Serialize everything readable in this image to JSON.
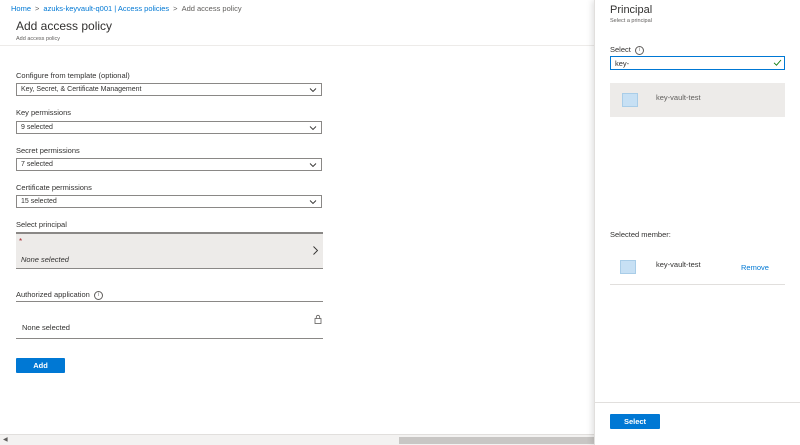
{
  "breadcrumb": {
    "home": "Home",
    "vault": "azuks-keyvault-q001 | Access policies",
    "current": "Add access policy"
  },
  "page": {
    "title": "Add access policy",
    "subtitle": "Add access policy"
  },
  "form": {
    "template_label": "Configure from template (optional)",
    "template_value": "Key, Secret, & Certificate Management",
    "key_label": "Key permissions",
    "key_value": "9 selected",
    "secret_label": "Secret permissions",
    "secret_value": "7 selected",
    "cert_label": "Certificate permissions",
    "cert_value": "15 selected",
    "principal_label": "Select principal",
    "principal_required": "*",
    "principal_value": "None selected",
    "auth_label": "Authorized application",
    "auth_value": "None selected",
    "add_button": "Add"
  },
  "panel": {
    "title": "Principal",
    "subtitle": "Select a principal",
    "select_label": "Select",
    "search_value": "key-",
    "result_name": "key-vault-test",
    "selected_member_label": "Selected member:",
    "member_name": "key-vault-test",
    "remove_label": "Remove",
    "select_button": "Select"
  },
  "colors": {
    "accent": "#0078d4",
    "required": "#a4262c"
  }
}
